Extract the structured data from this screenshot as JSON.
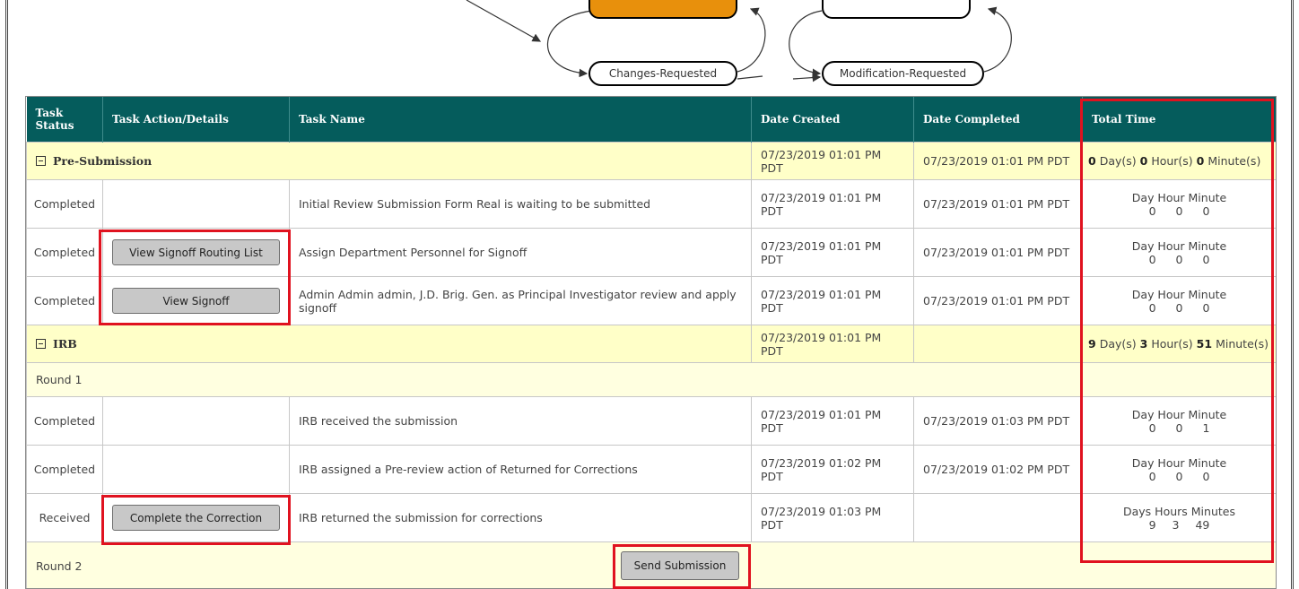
{
  "diagram": {
    "node_changes_requested": "Changes-Requested",
    "node_modification_requested": "Modification-Requested"
  },
  "table": {
    "headers": {
      "task_status": "Task Status",
      "task_action": "Task Action/Details",
      "task_name": "Task Name",
      "date_created": "Date Created",
      "date_completed": "Date Completed",
      "total_time": "Total Time"
    },
    "time_labels": {
      "singular": "Day Hour Minute",
      "plural": "Days Hours Minutes",
      "day_unit": "Day(s)",
      "hour_unit": "Hour(s)",
      "minute_unit": "Minute(s)"
    },
    "pre_submission": {
      "label": "Pre-Submission",
      "date_created": "07/23/2019 01:01 PM PDT",
      "date_completed": "07/23/2019 01:01 PM PDT",
      "total_days": "0",
      "total_hours": "0",
      "total_minutes": "0",
      "rows": [
        {
          "status": "Completed",
          "action": "",
          "name": "Initial Review Submission Form Real is waiting to be submitted",
          "date_created": "07/23/2019 01:01 PM PDT",
          "date_completed": "07/23/2019 01:01 PM PDT",
          "time_values": "0 0 0"
        },
        {
          "status": "Completed",
          "action": "View Signoff Routing List",
          "name": "Assign Department Personnel for Signoff",
          "date_created": "07/23/2019 01:01 PM PDT",
          "date_completed": "07/23/2019 01:01 PM PDT",
          "time_values": "0 0 0"
        },
        {
          "status": "Completed",
          "action": "View Signoff",
          "name": "Admin Admin admin, J.D. Brig. Gen. as Principal Investigator review and apply signoff",
          "date_created": "07/23/2019 01:01 PM PDT",
          "date_completed": "07/23/2019 01:01 PM PDT",
          "time_values": "0 0 0"
        }
      ]
    },
    "irb": {
      "label": "IRB",
      "date_created": "07/23/2019 01:01 PM PDT",
      "date_completed": "",
      "total_days": "9",
      "total_hours": "3",
      "total_minutes": "51",
      "round1_label": "Round 1",
      "rows": [
        {
          "status": "Completed",
          "action": "",
          "name": "IRB received the submission",
          "date_created": "07/23/2019 01:01 PM PDT",
          "date_completed": "07/23/2019 01:03 PM PDT",
          "time_values": "0 0 1"
        },
        {
          "status": "Completed",
          "action": "",
          "name": "IRB assigned a Pre-review action of Returned for Corrections",
          "date_created": "07/23/2019 01:02 PM PDT",
          "date_completed": "07/23/2019 01:02 PM PDT",
          "time_values": "0 0 0"
        },
        {
          "status": "Received",
          "action": "Complete the Correction",
          "name": "IRB returned the submission for corrections",
          "date_created": "07/23/2019 01:03 PM PDT",
          "date_completed": "",
          "time_values": "9 3 49"
        }
      ],
      "round2_label": "Round 2",
      "send_button": "Send Submission"
    }
  },
  "colors": {
    "header_bg": "#055c5c",
    "section_bg": "#ffffc8",
    "highlight_red": "#e0121f",
    "orange_node": "#e8900c"
  }
}
